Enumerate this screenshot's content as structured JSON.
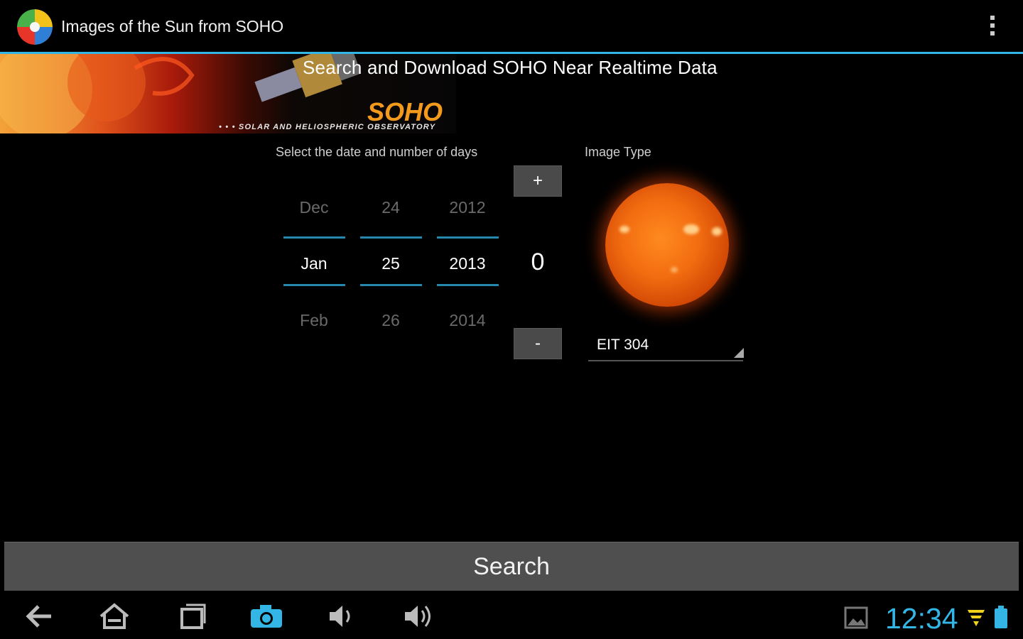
{
  "action_bar": {
    "title": "Images of the Sun from SOHO"
  },
  "banner": {
    "heading": "Search and Download SOHO Near Realtime Data",
    "logo_text": "SOHO",
    "logo_subtitle": "• • • SOLAR AND HELIOSPHERIC OBSERVATORY"
  },
  "date_section": {
    "label": "Select the date and number of days",
    "month": {
      "prev": "Dec",
      "current": "Jan",
      "next": "Feb"
    },
    "day": {
      "prev": "24",
      "current": "25",
      "next": "26"
    },
    "year": {
      "prev": "2012",
      "current": "2013",
      "next": "2014"
    }
  },
  "days_stepper": {
    "increment_label": "+",
    "value": "0",
    "decrement_label": "-"
  },
  "image_type": {
    "label": "Image Type",
    "selected": "EIT 304"
  },
  "search_button": {
    "label": "Search"
  },
  "system_bar": {
    "clock": "12:34",
    "icons": [
      "back-icon",
      "home-icon",
      "recent-apps-icon",
      "camera-icon",
      "volume-down-icon",
      "volume-up-icon",
      "gallery-notification-icon",
      "wifi-icon",
      "battery-icon"
    ]
  },
  "colors": {
    "accent": "#33b5e5",
    "button_bg": "#4f4f4f",
    "background": "#000000",
    "logo_orange": "#f39a1c"
  }
}
